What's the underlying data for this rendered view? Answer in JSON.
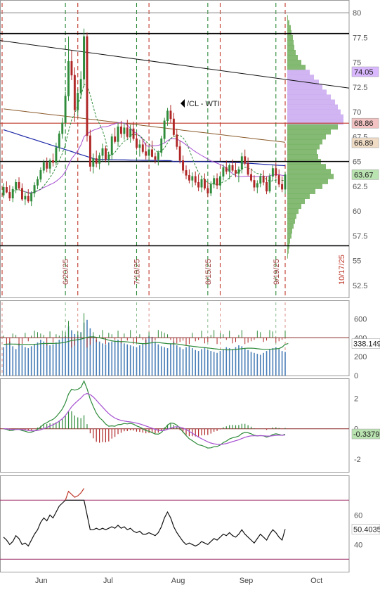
{
  "symbol_label": "/CL - WTI",
  "colors": {
    "up": "#2e8b3a",
    "down": "#b02727",
    "ma_brown": "#8b5a2b",
    "ma_blue": "#1f2aa8",
    "ma_violet": "#a64fd1",
    "ma_green_dashed": "#2e8b3a",
    "volume_bar": "#4a7fb8",
    "profile_green": "#6fae5a",
    "profile_violet": "#c9a8f0",
    "badge_violet": "#d9b8ff",
    "badge_red": "#f3c2c2",
    "badge_brown": "#f0dcc5",
    "badge_green": "#b9e3b0",
    "hline_black": "#000000",
    "hline_red": "#c0392b",
    "vline_green": "#2e8b3a",
    "vline_red": "#c0392b"
  },
  "chart_data": [
    {
      "type": "candlestick",
      "panel": "price",
      "y_ticks": [
        "80",
        "77.5",
        "75",
        "72.5",
        "70",
        "67.5",
        "65",
        "62.5",
        "60",
        "57.5",
        "55",
        "52.5"
      ],
      "ylim": [
        51.5,
        81
      ],
      "x_month_labels": [
        "Jun",
        "Jul",
        "Aug",
        "Sep",
        "Oct"
      ],
      "x_date_labels": [
        "6/20/25",
        "7/18/25",
        "8/15/25",
        "9/19/25",
        "10/17/25"
      ],
      "annotations": [
        "/CL - WTI"
      ],
      "price_badges": [
        {
          "text": "74.05",
          "value": 74.05
        },
        {
          "text": "68.86",
          "value": 68.86
        },
        {
          "text": "66.89",
          "value": 66.89
        },
        {
          "text": "63.67",
          "value": 63.67
        }
      ],
      "horizontal_lines": [
        {
          "value": 80.0,
          "style": "gray"
        },
        {
          "value": 77.9,
          "style": "black"
        },
        {
          "value": 65.0,
          "style": "black"
        },
        {
          "value": 56.5,
          "style": "black"
        },
        {
          "value": 68.86,
          "style": "red"
        }
      ],
      "trendline": {
        "from": [
          0,
          77.2
        ],
        "to": [
          136,
          72.4
        ]
      },
      "candles": [
        [
          61.6,
          62.8,
          61.3,
          62.4
        ],
        [
          62.4,
          63.0,
          61.8,
          61.9
        ],
        [
          61.9,
          62.6,
          61.0,
          61.3
        ],
        [
          61.3,
          62.5,
          60.9,
          62.2
        ],
        [
          62.2,
          63.2,
          61.8,
          62.9
        ],
        [
          62.9,
          63.4,
          62.1,
          62.3
        ],
        [
          62.3,
          62.8,
          61.0,
          61.2
        ],
        [
          61.2,
          61.9,
          60.6,
          61.5
        ],
        [
          61.5,
          62.2,
          60.8,
          61.0
        ],
        [
          61.0,
          62.0,
          60.5,
          61.8
        ],
        [
          61.8,
          62.9,
          61.4,
          62.6
        ],
        [
          62.6,
          63.5,
          62.2,
          63.2
        ],
        [
          63.2,
          64.4,
          62.9,
          64.1
        ],
        [
          64.1,
          65.2,
          63.8,
          64.9
        ],
        [
          64.9,
          65.4,
          63.9,
          64.3
        ],
        [
          64.3,
          65.3,
          63.8,
          65.1
        ],
        [
          65.1,
          65.8,
          64.5,
          64.9
        ],
        [
          64.9,
          66.9,
          64.6,
          66.4
        ],
        [
          66.4,
          68.1,
          66.0,
          67.8
        ],
        [
          67.8,
          69.4,
          67.3,
          68.9
        ],
        [
          68.9,
          72.0,
          68.5,
          71.6
        ],
        [
          71.6,
          77.6,
          71.1,
          75.1
        ],
        [
          75.1,
          76.2,
          73.2,
          73.7
        ],
        [
          73.7,
          74.5,
          69.0,
          70.2
        ],
        [
          70.2,
          72.3,
          69.6,
          71.9
        ],
        [
          71.9,
          74.1,
          71.3,
          73.3
        ],
        [
          73.3,
          78.4,
          72.5,
          77.6
        ],
        [
          77.6,
          78.0,
          67.0,
          67.6
        ],
        [
          67.6,
          68.2,
          64.0,
          64.5
        ],
        [
          64.5,
          65.8,
          63.8,
          65.3
        ],
        [
          65.3,
          66.1,
          64.4,
          64.8
        ],
        [
          64.8,
          65.9,
          64.2,
          65.6
        ],
        [
          65.6,
          66.8,
          65.0,
          66.3
        ],
        [
          66.3,
          66.6,
          64.9,
          65.2
        ],
        [
          65.2,
          66.0,
          64.6,
          65.7
        ],
        [
          65.7,
          67.8,
          65.2,
          67.5
        ],
        [
          67.5,
          68.4,
          66.8,
          67.0
        ],
        [
          67.0,
          68.9,
          66.5,
          68.5
        ],
        [
          68.5,
          69.1,
          67.4,
          67.8
        ],
        [
          67.8,
          68.9,
          67.2,
          68.4
        ],
        [
          68.4,
          69.2,
          67.3,
          67.5
        ],
        [
          67.5,
          68.7,
          66.9,
          68.3
        ],
        [
          68.3,
          69.0,
          67.1,
          67.3
        ],
        [
          67.3,
          67.9,
          66.2,
          66.4
        ],
        [
          66.4,
          67.2,
          65.5,
          66.7
        ],
        [
          66.7,
          67.3,
          65.8,
          66.0
        ],
        [
          66.0,
          66.9,
          65.2,
          65.6
        ],
        [
          65.6,
          66.5,
          65.0,
          66.2
        ],
        [
          66.2,
          67.1,
          65.4,
          65.5
        ],
        [
          65.5,
          65.9,
          64.8,
          65.2
        ],
        [
          65.2,
          66.1,
          64.6,
          65.9
        ],
        [
          65.9,
          67.6,
          65.5,
          67.3
        ],
        [
          67.3,
          69.4,
          66.9,
          69.1
        ],
        [
          69.1,
          70.4,
          68.6,
          70.1
        ],
        [
          70.1,
          70.7,
          68.9,
          69.3
        ],
        [
          69.3,
          69.9,
          67.5,
          67.7
        ],
        [
          67.7,
          68.3,
          66.2,
          66.5
        ],
        [
          66.5,
          67.1,
          64.8,
          65.1
        ],
        [
          65.1,
          65.6,
          63.8,
          64.1
        ],
        [
          64.1,
          64.6,
          63.2,
          63.6
        ],
        [
          63.6,
          64.2,
          62.8,
          63.1
        ],
        [
          63.1,
          63.9,
          62.4,
          63.5
        ],
        [
          63.5,
          64.0,
          62.6,
          62.9
        ],
        [
          62.9,
          63.7,
          62.0,
          62.4
        ],
        [
          62.4,
          63.5,
          61.9,
          63.2
        ],
        [
          63.2,
          63.8,
          62.1,
          62.3
        ],
        [
          62.3,
          62.9,
          61.4,
          61.8
        ],
        [
          61.8,
          63.0,
          61.5,
          62.7
        ],
        [
          62.7,
          63.6,
          62.3,
          63.3
        ],
        [
          63.3,
          63.8,
          62.2,
          62.6
        ],
        [
          62.6,
          63.8,
          62.1,
          63.5
        ],
        [
          63.5,
          64.7,
          63.1,
          64.4
        ],
        [
          64.4,
          65.1,
          63.7,
          64.0
        ],
        [
          64.0,
          64.8,
          63.2,
          64.6
        ],
        [
          64.6,
          65.2,
          63.9,
          64.1
        ],
        [
          64.1,
          64.9,
          63.4,
          63.8
        ],
        [
          63.8,
          64.5,
          62.9,
          64.2
        ],
        [
          64.2,
          65.9,
          63.8,
          65.5
        ],
        [
          65.5,
          66.2,
          64.6,
          64.8
        ],
        [
          64.8,
          65.4,
          63.5,
          63.7
        ],
        [
          63.7,
          64.3,
          62.9,
          63.1
        ],
        [
          63.1,
          63.6,
          62.0,
          62.4
        ],
        [
          62.4,
          63.1,
          61.8,
          62.8
        ],
        [
          62.8,
          63.8,
          62.4,
          63.5
        ],
        [
          63.5,
          64.1,
          62.6,
          62.9
        ],
        [
          62.9,
          63.5,
          61.7,
          62.0
        ],
        [
          62.0,
          63.8,
          61.8,
          63.5
        ],
        [
          63.5,
          64.6,
          63.1,
          64.3
        ],
        [
          64.3,
          64.9,
          63.3,
          63.6
        ],
        [
          63.6,
          64.2,
          62.4,
          62.7
        ],
        [
          62.7,
          63.5,
          61.9,
          62.2
        ],
        [
          62.2,
          63.9,
          61.7,
          63.67
        ]
      ],
      "volume_profile": [
        {
          "price": 79.5,
          "w": 1
        },
        {
          "price": 79.0,
          "w": 3
        },
        {
          "price": 78.5,
          "w": 5
        },
        {
          "price": 78.0,
          "w": 6
        },
        {
          "price": 77.5,
          "w": 8
        },
        {
          "price": 77.0,
          "w": 9
        },
        {
          "price": 76.5,
          "w": 10
        },
        {
          "price": 76.0,
          "w": 12
        },
        {
          "price": 75.5,
          "w": 15
        },
        {
          "price": 75.0,
          "w": 20
        },
        {
          "price": 74.5,
          "w": 26
        },
        {
          "price": 74.0,
          "w": 32
        },
        {
          "price": 73.5,
          "w": 38
        },
        {
          "price": 73.0,
          "w": 45
        },
        {
          "price": 72.5,
          "w": 50
        },
        {
          "price": 72.0,
          "w": 56
        },
        {
          "price": 71.5,
          "w": 62
        },
        {
          "price": 71.0,
          "w": 68
        },
        {
          "price": 70.5,
          "w": 72
        },
        {
          "price": 70.0,
          "w": 76
        },
        {
          "price": 69.5,
          "w": 80
        },
        {
          "price": 69.0,
          "w": 80
        },
        {
          "price": 68.5,
          "w": 72
        },
        {
          "price": 68.0,
          "w": 62
        },
        {
          "price": 67.5,
          "w": 55
        },
        {
          "price": 67.0,
          "w": 50
        },
        {
          "price": 66.5,
          "w": 46
        },
        {
          "price": 66.0,
          "w": 42
        },
        {
          "price": 65.5,
          "w": 44
        },
        {
          "price": 65.0,
          "w": 48
        },
        {
          "price": 64.5,
          "w": 55
        },
        {
          "price": 64.0,
          "w": 62
        },
        {
          "price": 63.5,
          "w": 66
        },
        {
          "price": 63.0,
          "w": 58
        },
        {
          "price": 62.5,
          "w": 50
        },
        {
          "price": 62.0,
          "w": 40
        },
        {
          "price": 61.5,
          "w": 32
        },
        {
          "price": 61.0,
          "w": 25
        },
        {
          "price": 60.5,
          "w": 20
        },
        {
          "price": 60.0,
          "w": 16
        },
        {
          "price": 59.5,
          "w": 13
        },
        {
          "price": 59.0,
          "w": 11
        },
        {
          "price": 58.5,
          "w": 9
        },
        {
          "price": 58.0,
          "w": 7
        },
        {
          "price": 57.5,
          "w": 6
        },
        {
          "price": 57.0,
          "w": 4
        },
        {
          "price": 56.5,
          "w": 3
        },
        {
          "price": 56.0,
          "w": 2
        },
        {
          "price": 55.5,
          "w": 1
        }
      ]
    },
    {
      "type": "bar",
      "panel": "volume",
      "y_ticks": [
        "600",
        "400",
        "200",
        "0"
      ],
      "ylim": [
        0,
        730
      ],
      "last_value_badge": "338.149",
      "values": [
        300,
        330,
        360,
        310,
        280,
        340,
        320,
        300,
        290,
        310,
        330,
        350,
        380,
        360,
        340,
        320,
        330,
        350,
        380,
        400,
        420,
        520,
        480,
        440,
        430,
        460,
        560,
        590,
        500,
        420,
        380,
        360,
        340,
        330,
        350,
        360,
        370,
        380,
        360,
        340,
        330,
        320,
        310,
        300,
        320,
        340,
        380,
        420,
        410,
        360,
        330,
        310,
        300,
        290,
        340,
        360,
        320,
        300,
        280,
        300,
        310,
        290,
        270,
        260,
        280,
        300,
        270,
        260,
        250,
        240,
        260,
        280,
        300,
        290,
        280,
        300,
        320,
        310,
        290,
        270,
        250,
        240,
        230,
        220,
        240,
        260,
        280,
        290,
        300,
        280,
        260,
        250
      ],
      "avg_line": [
        330,
        332,
        334,
        333,
        332,
        331,
        330,
        330,
        329,
        330,
        331,
        333,
        337,
        339,
        340,
        340,
        340,
        341,
        343,
        347,
        352,
        362,
        370,
        375,
        380,
        385,
        395,
        405,
        410,
        410,
        405,
        400,
        392,
        385,
        375,
        368,
        362,
        360,
        360,
        358,
        356,
        352,
        348,
        344,
        340,
        338,
        338,
        343,
        347,
        352,
        350,
        346,
        342,
        338,
        336,
        336,
        334,
        330,
        324,
        318,
        314,
        310,
        306,
        302,
        298,
        296,
        292,
        288,
        284,
        280,
        276,
        274,
        272,
        272,
        273,
        276,
        280,
        284,
        288,
        290,
        290,
        288,
        284,
        280,
        278,
        278,
        278,
        280,
        283,
        286,
        300,
        330,
        338
      ]
    },
    {
      "type": "line",
      "panel": "macd",
      "y_ticks": [
        "2",
        "0",
        "-2"
      ],
      "ylim": [
        -2.7,
        3.0
      ],
      "last_value_badge": "-0.3379"
    },
    {
      "type": "line",
      "panel": "rsi",
      "y_ticks": [
        "60",
        "40"
      ],
      "ylim": [
        23,
        83
      ],
      "last_value_badge": "50.4035",
      "overbought": 70,
      "oversold": 30,
      "values": [
        45,
        43,
        40,
        42,
        46,
        44,
        40,
        41,
        39,
        43,
        47,
        50,
        55,
        58,
        56,
        60,
        58,
        62,
        66,
        68,
        70,
        76,
        74,
        72,
        73,
        75,
        78,
        60,
        50,
        50,
        51,
        50,
        51,
        50,
        51,
        52,
        51,
        53,
        51,
        52,
        50,
        51,
        49,
        48,
        49,
        47,
        47,
        48,
        47,
        46,
        48,
        52,
        58,
        62,
        58,
        52,
        48,
        45,
        42,
        40,
        41,
        40,
        39,
        40,
        42,
        41,
        40,
        42,
        44,
        43,
        45,
        47,
        46,
        48,
        46,
        45,
        47,
        50,
        47,
        45,
        43,
        41,
        44,
        47,
        45,
        43,
        47,
        50,
        48,
        45,
        43,
        50.4
      ]
    }
  ]
}
